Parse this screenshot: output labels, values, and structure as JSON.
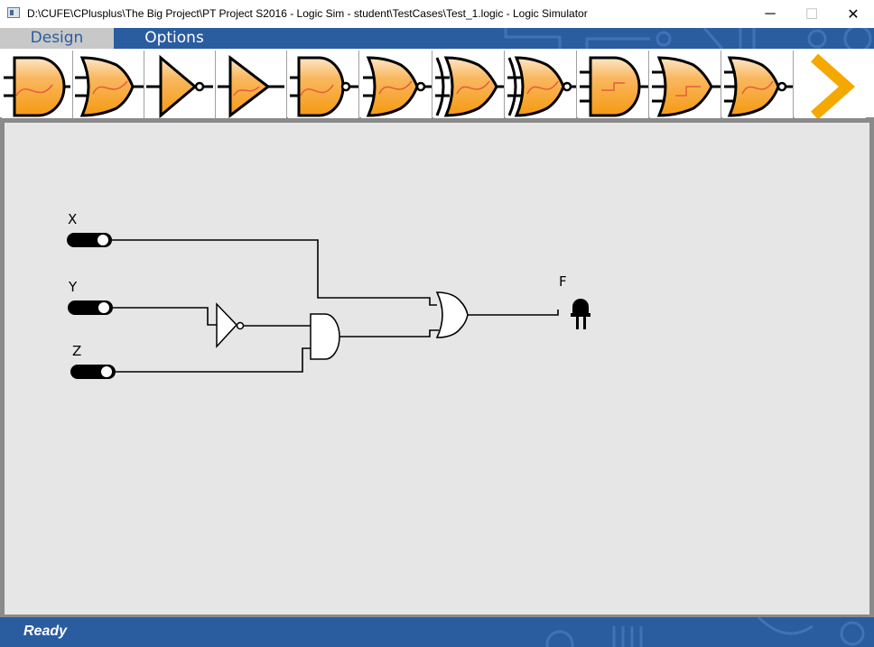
{
  "window": {
    "title": "D:\\CUFE\\CPlusplus\\The Big Project\\PT Project S2016 - Logic Sim - student\\TestCases\\Test_1.logic - Logic Simulator",
    "app_icon": "app-window-icon",
    "minimize_glyph": "─",
    "maximize_glyph": "☐",
    "close_glyph": "✕"
  },
  "menu": {
    "tabs": [
      {
        "label": "Design",
        "active": true
      },
      {
        "label": "Options",
        "active": false
      }
    ]
  },
  "toolbar": {
    "tools": [
      {
        "icon": "and-gate-icon"
      },
      {
        "icon": "or-gate-icon"
      },
      {
        "icon": "not-gate-icon"
      },
      {
        "icon": "buffer-gate-icon"
      },
      {
        "icon": "nand-gate-icon"
      },
      {
        "icon": "nor-gate-icon"
      },
      {
        "icon": "xor-gate-icon"
      },
      {
        "icon": "xnor-gate-icon"
      },
      {
        "icon": "and3-gate-icon"
      },
      {
        "icon": "or3-gate-icon"
      },
      {
        "icon": "nor3-gate-icon"
      },
      {
        "icon": "next-arrow-icon"
      }
    ],
    "icon_fill": "#f7a11a",
    "arrow_color": "#f5a800"
  },
  "circuit": {
    "labels": {
      "x": "X",
      "y": "Y",
      "z": "Z",
      "f": "F"
    },
    "components": [
      "switch-x",
      "switch-y",
      "switch-z",
      "not-gate",
      "and-gate",
      "or-gate",
      "led-f"
    ]
  },
  "status": {
    "text": "Ready"
  },
  "colors": {
    "menubar": "#2a5ca0",
    "canvas": "#e6e6e6",
    "active_tab_bg": "#c8c8c8"
  }
}
